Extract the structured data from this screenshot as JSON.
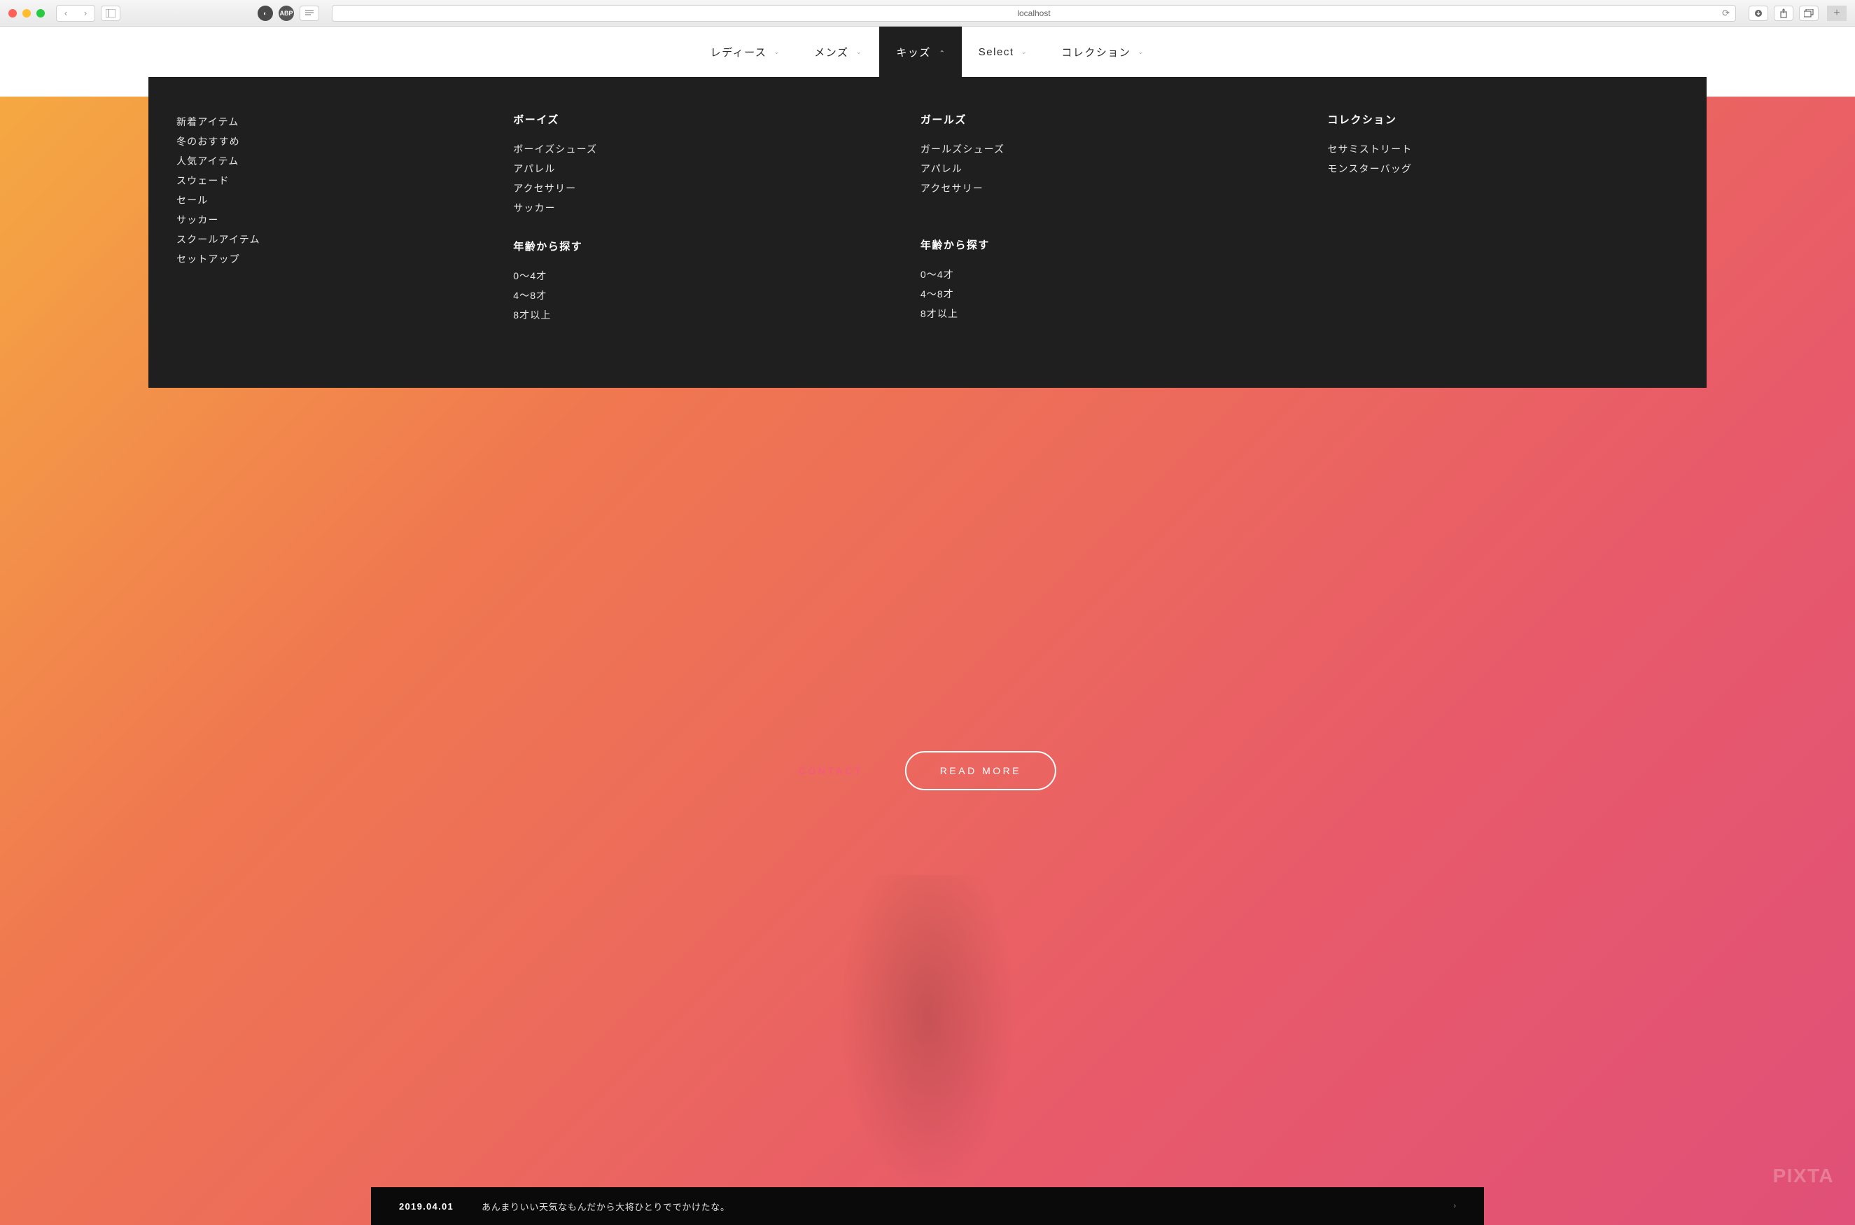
{
  "browser": {
    "url": "localhost"
  },
  "nav": {
    "items": [
      {
        "label": "レディース",
        "active": false
      },
      {
        "label": "メンズ",
        "active": false
      },
      {
        "label": "キッズ",
        "active": true
      },
      {
        "label": "Select",
        "active": false
      },
      {
        "label": "コレクション",
        "active": false
      }
    ]
  },
  "mega_menu": {
    "col1": {
      "links": [
        "新着アイテム",
        "冬のおすすめ",
        "人気アイテム",
        "スウェード",
        "セール",
        "サッカー",
        "スクールアイテム",
        "セットアップ"
      ]
    },
    "col2": {
      "section1": {
        "heading": "ボーイズ",
        "links": [
          "ボーイズシューズ",
          "アパレル",
          "アクセサリー",
          "サッカー"
        ]
      },
      "section2": {
        "heading": "年齢から探す",
        "links": [
          "0〜4才",
          "4〜8才",
          "8才以上"
        ]
      }
    },
    "col3": {
      "section1": {
        "heading": "ガールズ",
        "links": [
          "ガールズシューズ",
          "アパレル",
          "アクセサリー"
        ]
      },
      "section2": {
        "heading": "年齢から探す",
        "links": [
          "0〜4才",
          "4〜8才",
          "8才以上"
        ]
      }
    },
    "col4": {
      "heading": "コレクション",
      "links": [
        "セサミストリート",
        "モンスターバッグ"
      ]
    }
  },
  "hero": {
    "contact_label": "CONTACT",
    "read_more_label": "READ MORE",
    "watermark": "PIXTA"
  },
  "news": {
    "date": "2019.04.01",
    "text": "あんまりいい天気なもんだから大将ひとりででかけたな。"
  }
}
